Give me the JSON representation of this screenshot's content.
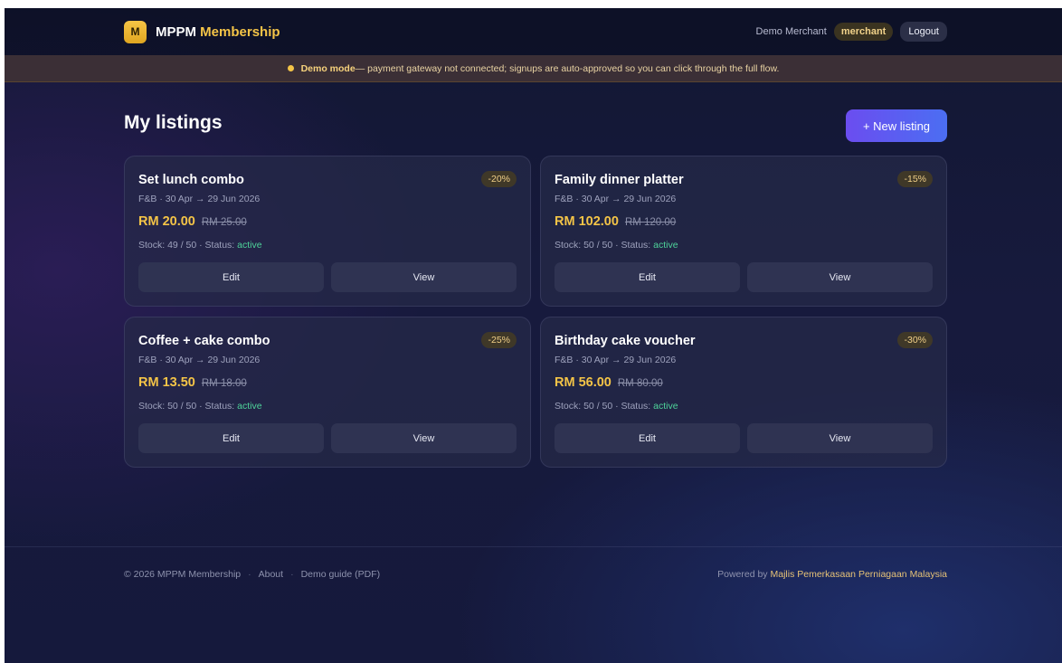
{
  "brand": {
    "logo_letter": "M",
    "name": "MPPM",
    "accent": "Membership"
  },
  "user": {
    "name": "Demo Merchant",
    "role": "merchant",
    "logout_label": "Logout"
  },
  "banner": {
    "label": "Demo mode",
    "text": " — payment gateway not connected; signups are auto-approved so you can click through the full flow."
  },
  "page": {
    "title": "My listings",
    "new_button": "+ New listing"
  },
  "listings": [
    {
      "title": "Set lunch combo",
      "discount": "-20%",
      "meta": "F&B · 30 Apr → 29 Jun 2026",
      "price": "RM 20.00",
      "old_price": "RM 25.00",
      "stock": "Stock: 49 / 50 · Status: ",
      "status": "active",
      "edit": "Edit",
      "view": "View"
    },
    {
      "title": "Family dinner platter",
      "discount": "-15%",
      "meta": "F&B · 30 Apr → 29 Jun 2026",
      "price": "RM 102.00",
      "old_price": "RM 120.00",
      "stock": "Stock: 50 / 50 · Status: ",
      "status": "active",
      "edit": "Edit",
      "view": "View"
    },
    {
      "title": "Coffee + cake combo",
      "discount": "-25%",
      "meta": "F&B · 30 Apr → 29 Jun 2026",
      "price": "RM 13.50",
      "old_price": "RM 18.00",
      "stock": "Stock: 50 / 50 · Status: ",
      "status": "active",
      "edit": "Edit",
      "view": "View"
    },
    {
      "title": "Birthday cake voucher",
      "discount": "-30%",
      "meta": "F&B · 30 Apr → 29 Jun 2026",
      "price": "RM 56.00",
      "old_price": "RM 80.00",
      "stock": "Stock: 50 / 50 · Status: ",
      "status": "active",
      "edit": "Edit",
      "view": "View"
    }
  ],
  "footer": {
    "copyright": "© 2026 MPPM Membership",
    "about": "About",
    "guide": "Demo guide (PDF)",
    "powered_by": "Powered by ",
    "org": "Majlis Pemerkasaan Perniagaan Malaysia"
  },
  "colors": {
    "accent_gold": "#f4c447",
    "primary_gradient": "#6b4df0",
    "status_active": "#4ed39a"
  }
}
